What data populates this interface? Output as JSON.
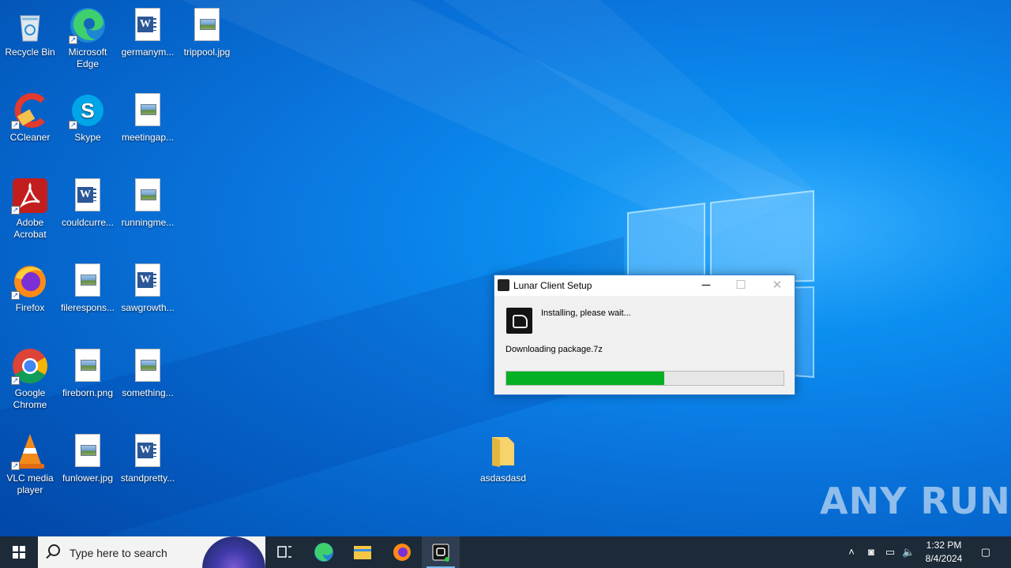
{
  "desktop": {
    "icons": [
      {
        "label": "Recycle Bin"
      },
      {
        "label": "Microsoft Edge"
      },
      {
        "label": "germanym..."
      },
      {
        "label": "trippool.jpg"
      },
      {
        "label": "CCleaner"
      },
      {
        "label": "Skype"
      },
      {
        "label": "meetingap..."
      },
      {
        "label": "Adobe Acrobat"
      },
      {
        "label": "couldcurre..."
      },
      {
        "label": "runningme..."
      },
      {
        "label": "Firefox"
      },
      {
        "label": "filerespons..."
      },
      {
        "label": "sawgrowth..."
      },
      {
        "label": "Google Chrome"
      },
      {
        "label": "fireborn.png"
      },
      {
        "label": "something..."
      },
      {
        "label": "VLC media player"
      },
      {
        "label": "funlower.jpg"
      },
      {
        "label": "standpretty..."
      },
      {
        "label": "asdasdasd"
      }
    ]
  },
  "setup_window": {
    "title": "Lunar Client Setup",
    "minimize_glyph": "─",
    "maximize_glyph": "☐",
    "close_glyph": "✕",
    "status": "Installing, please wait...",
    "detail": "Downloading package.7z",
    "progress_fraction": 0.57,
    "progress_color": "#06b025"
  },
  "watermark": "ANY RUN",
  "taskbar": {
    "search_placeholder": "Type here to search",
    "time": "1:32 PM",
    "date": "8/4/2024"
  },
  "colors": {
    "taskbar_bg": "#1d2a38",
    "accent": "#0a78e0"
  }
}
